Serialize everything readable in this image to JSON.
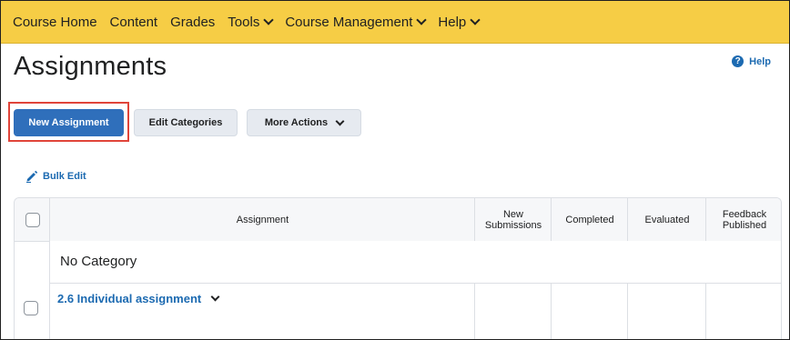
{
  "nav": {
    "items": [
      {
        "label": "Course Home",
        "has_dropdown": false
      },
      {
        "label": "Content",
        "has_dropdown": false
      },
      {
        "label": "Grades",
        "has_dropdown": false
      },
      {
        "label": "Tools",
        "has_dropdown": true
      },
      {
        "label": "Course Management",
        "has_dropdown": true
      },
      {
        "label": "Help",
        "has_dropdown": true
      }
    ],
    "bg_color": "#f6cd45"
  },
  "page": {
    "title": "Assignments",
    "help_label": "Help"
  },
  "actions": {
    "new_assignment": "New Assignment",
    "edit_categories": "Edit Categories",
    "more_actions": "More Actions",
    "bulk_edit": "Bulk Edit"
  },
  "table": {
    "headers": {
      "assignment": "Assignment",
      "new_submissions": "New Submissions",
      "completed": "Completed",
      "evaluated": "Evaluated",
      "feedback_published": "Feedback Published"
    },
    "category": "No Category",
    "rows": [
      {
        "name": "2.6 Individual assignment"
      }
    ]
  },
  "colors": {
    "primary": "#2f6fbb",
    "link": "#1c6ab1",
    "highlight": "#e0443a"
  }
}
